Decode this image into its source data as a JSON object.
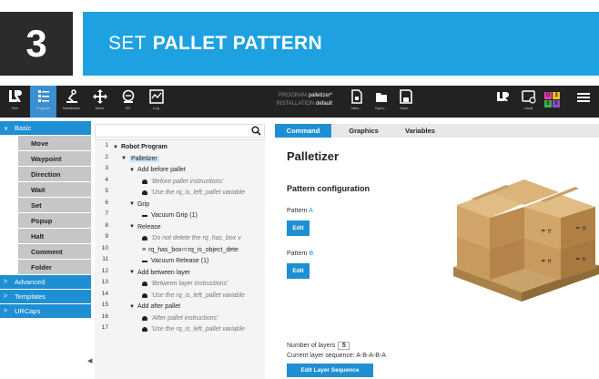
{
  "banner": {
    "step_number": "3",
    "title_thin": "SET",
    "title_bold": "PALLET PATTERN",
    "accent": "#1da1e0"
  },
  "topbar": {
    "buttons": [
      {
        "label": "Run",
        "icon": "ur-logo-icon"
      },
      {
        "label": "Program",
        "icon": "program-icon"
      },
      {
        "label": "Installation",
        "icon": "installation-icon"
      },
      {
        "label": "Move",
        "icon": "move-icon"
      },
      {
        "label": "I/O",
        "icon": "io-icon"
      },
      {
        "label": "Log",
        "icon": "log-icon"
      }
    ],
    "program_label": "PROGRAM",
    "program_value": "palletizer*",
    "installation_label": "INSTALLATION",
    "installation_value": "default",
    "file_buttons": [
      {
        "label": "New..."
      },
      {
        "label": "Open..."
      },
      {
        "label": "Save..."
      }
    ],
    "local_label": "Local",
    "corner_digits": [
      "D",
      "3",
      "6",
      "8"
    ]
  },
  "sidebar": {
    "sections": [
      {
        "label": "Basic",
        "expanded": true
      },
      {
        "label": "Advanced",
        "expanded": false
      },
      {
        "label": "Templates",
        "expanded": false
      },
      {
        "label": "URCaps",
        "expanded": false
      }
    ],
    "basic_items": [
      "Move",
      "Waypoint",
      "Direction",
      "Wait",
      "Set",
      "Popup",
      "Halt",
      "Comment",
      "Folder"
    ]
  },
  "tree": {
    "lines": [
      {
        "n": "1",
        "indent": 0,
        "caret": "▼",
        "kind": "none",
        "text": "Robot Program",
        "style": "bold"
      },
      {
        "n": "2",
        "indent": 1,
        "caret": "▼",
        "kind": "none",
        "text": "Palletizer",
        "style": "sel"
      },
      {
        "n": "3",
        "indent": 2,
        "caret": "▼",
        "kind": "none",
        "text": "Add before pallet",
        "style": ""
      },
      {
        "n": "4",
        "indent": 3,
        "caret": "",
        "kind": "dot",
        "text": "'Before pallet instructions'",
        "style": "it"
      },
      {
        "n": "5",
        "indent": 3,
        "caret": "",
        "kind": "dot",
        "text": "'Use the rq_is_left_pallet variable",
        "style": "it"
      },
      {
        "n": "6",
        "indent": 2,
        "caret": "▼",
        "kind": "none",
        "text": "Grip",
        "style": ""
      },
      {
        "n": "7",
        "indent": 3,
        "caret": "",
        "kind": "dash",
        "text": "Vacuum Grip  (1)",
        "style": ""
      },
      {
        "n": "8",
        "indent": 2,
        "caret": "▼",
        "kind": "none",
        "text": "Release",
        "style": ""
      },
      {
        "n": "9",
        "indent": 3,
        "caret": "",
        "kind": "dot",
        "text": "'Do not delete the rq_has_box v",
        "style": "it"
      },
      {
        "n": "10",
        "indent": 3,
        "caret": "",
        "kind": "eq",
        "text": "rq_has_box≔rq_is_object_dete",
        "style": ""
      },
      {
        "n": "11",
        "indent": 3,
        "caret": "",
        "kind": "dash",
        "text": "Vacuum Release  (1)",
        "style": ""
      },
      {
        "n": "12",
        "indent": 2,
        "caret": "▼",
        "kind": "none",
        "text": "Add between layer",
        "style": ""
      },
      {
        "n": "13",
        "indent": 3,
        "caret": "",
        "kind": "dot",
        "text": "'Between layer instructions'",
        "style": "it"
      },
      {
        "n": "14",
        "indent": 3,
        "caret": "",
        "kind": "dot",
        "text": "'Use the rq_is_left_pallet variable",
        "style": "it"
      },
      {
        "n": "15",
        "indent": 2,
        "caret": "▼",
        "kind": "none",
        "text": "Add after pallet",
        "style": ""
      },
      {
        "n": "16",
        "indent": 3,
        "caret": "",
        "kind": "dot",
        "text": "'After pallet instructions'",
        "style": "it"
      },
      {
        "n": "17",
        "indent": 3,
        "caret": "",
        "kind": "dot",
        "text": "'Use the rq_is_left_pallet variable",
        "style": "it"
      }
    ]
  },
  "tabs": [
    "Command",
    "Graphics",
    "Variables"
  ],
  "content": {
    "title": "Palletizer",
    "subtitle": "Pattern configuration",
    "pattern_a_prefix": "Pattern ",
    "pattern_a_letter": "A",
    "pattern_b_prefix": "Pattern ",
    "pattern_b_letter": "B",
    "edit_label": "Edit",
    "layers_label": "Number of layers",
    "layers_value": "5",
    "sequence_label": "Current layer sequence: ",
    "sequence_value": "A-B-A-B-A",
    "edit_sequence_label": "Edit Layer Sequence"
  }
}
